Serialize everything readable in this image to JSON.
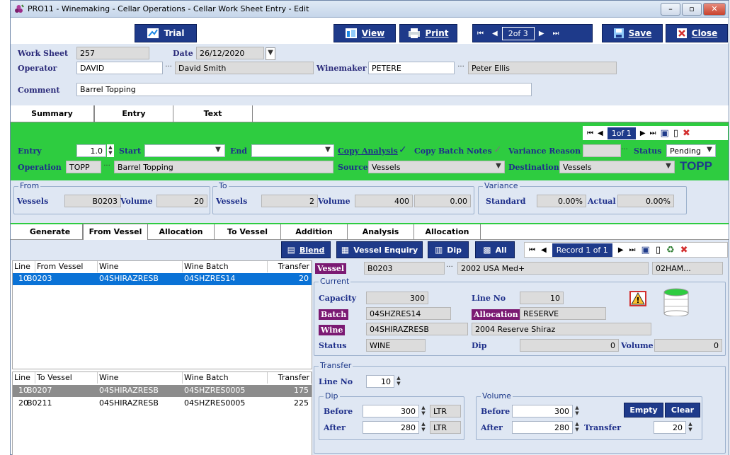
{
  "window": {
    "title": "PRO11 - Winemaking - Cellar Operations - Cellar Work Sheet Entry - Edit",
    "controls": [
      "–",
      "▫",
      "✕"
    ]
  },
  "toolbar": {
    "trial": "Trial",
    "view": "View",
    "print": "Print",
    "record": "2of 3",
    "save": "Save",
    "close": "Close"
  },
  "header": {
    "worksheet_label": "Work Sheet",
    "worksheet_value": "257",
    "date_label": "Date",
    "date_value": "26/12/2020",
    "operator_label": "Operator",
    "operator_code": "DAVID",
    "operator_name": "David Smith",
    "winemaker_label": "Winemaker",
    "winemaker_code": "PETERE",
    "winemaker_name": "Peter Ellis",
    "comment_label": "Comment",
    "comment_value": "Barrel Topping"
  },
  "tabs": [
    "Summary",
    "Entry",
    "Text"
  ],
  "entry": {
    "record": "1of 1",
    "entry_label": "Entry",
    "entry_value": "1.0",
    "start_label": "Start",
    "end_label": "End",
    "copy_analysis": "Copy Analysis",
    "copy_batch_notes": "Copy Batch Notes",
    "variance_reason": "Variance Reason",
    "status_label": "Status",
    "status_value": "Pending",
    "operation_label": "Operation",
    "operation_code": "TOPP",
    "operation_name": "Barrel Topping",
    "source_label": "Source",
    "source_value": "Vessels",
    "destination_label": "Destination",
    "destination_value": "Vessels",
    "badge": "TOPP"
  },
  "from": {
    "title": "From",
    "vessels_label": "Vessels",
    "vessels_value": "B0203",
    "volume_label": "Volume",
    "volume_value": "20"
  },
  "to": {
    "title": "To",
    "vessels_label": "Vessels",
    "vessels_value": "2",
    "volume_label": "Volume",
    "volume_value": "400",
    "extra_value": "0.00"
  },
  "variance": {
    "title": "Variance",
    "standard_label": "Standard",
    "standard_value": "0.00%",
    "actual_label": "Actual",
    "actual_value": "0.00%"
  },
  "subtabs": [
    "Generate",
    "From Vessel",
    "Allocation",
    "To Vessel",
    "Addition",
    "Analysis",
    "Allocation"
  ],
  "actions": {
    "blend": "Blend",
    "vessel_enquiry": "Vessel Enquiry",
    "dip": "Dip",
    "all": "All",
    "record": "Record 1 of 1"
  },
  "from_grid": {
    "headers": [
      "Line",
      "From Vessel",
      "Wine",
      "Wine Batch",
      "Transfer"
    ],
    "rows": [
      [
        "10",
        "B0203",
        "04SHIRAZRESB",
        "04SHZRES14",
        "20"
      ]
    ]
  },
  "to_grid": {
    "headers": [
      "Line",
      "To Vessel",
      "Wine",
      "Wine Batch",
      "Transfer"
    ],
    "rows": [
      [
        "10",
        "B0207",
        "04SHIRAZRESB",
        "04SHZRES0005",
        "175"
      ],
      [
        "20",
        "B0211",
        "04SHIRAZRESB",
        "04SHZRES0005",
        "225"
      ]
    ]
  },
  "vessel": {
    "label": "Vessel",
    "code": "B0203",
    "desc": "2002 USA Med+",
    "extra": "02HAM...",
    "current_title": "Current",
    "capacity_label": "Capacity",
    "capacity_value": "300",
    "lineno_label": "Line No",
    "lineno_value": "10",
    "batch_label": "Batch",
    "batch_value": "04SHZRES14",
    "allocation_label": "Allocation",
    "allocation_value": "RESERVE",
    "wine_label": "Wine",
    "wine_code": "04SHIRAZRESB",
    "wine_desc": "2004 Reserve Shiraz",
    "status_label": "Status",
    "status_value": "WINE",
    "dip_label": "Dip",
    "dip_value": "0",
    "volume_label": "Volume",
    "volume_value": "0"
  },
  "transfer": {
    "title": "Transfer",
    "lineno_label": "Line No",
    "lineno_value": "10",
    "dip_title": "Dip",
    "before_label": "Before",
    "before_value": "300",
    "unit": "LTR",
    "after_label": "After",
    "after_value": "280",
    "volume_title": "Volume",
    "vbefore_label": "Before",
    "vbefore_value": "300",
    "vafter_label": "After",
    "vafter_value": "280",
    "transfer_label": "Transfer",
    "transfer_value": "20",
    "empty": "Empty",
    "clear": "Clear"
  },
  "colors": {
    "navy": "#1e3a8a",
    "green": "#2ecc40",
    "panel": "#dfe7f3",
    "selected": "#0a72d6",
    "purple": "#7b1a73"
  }
}
